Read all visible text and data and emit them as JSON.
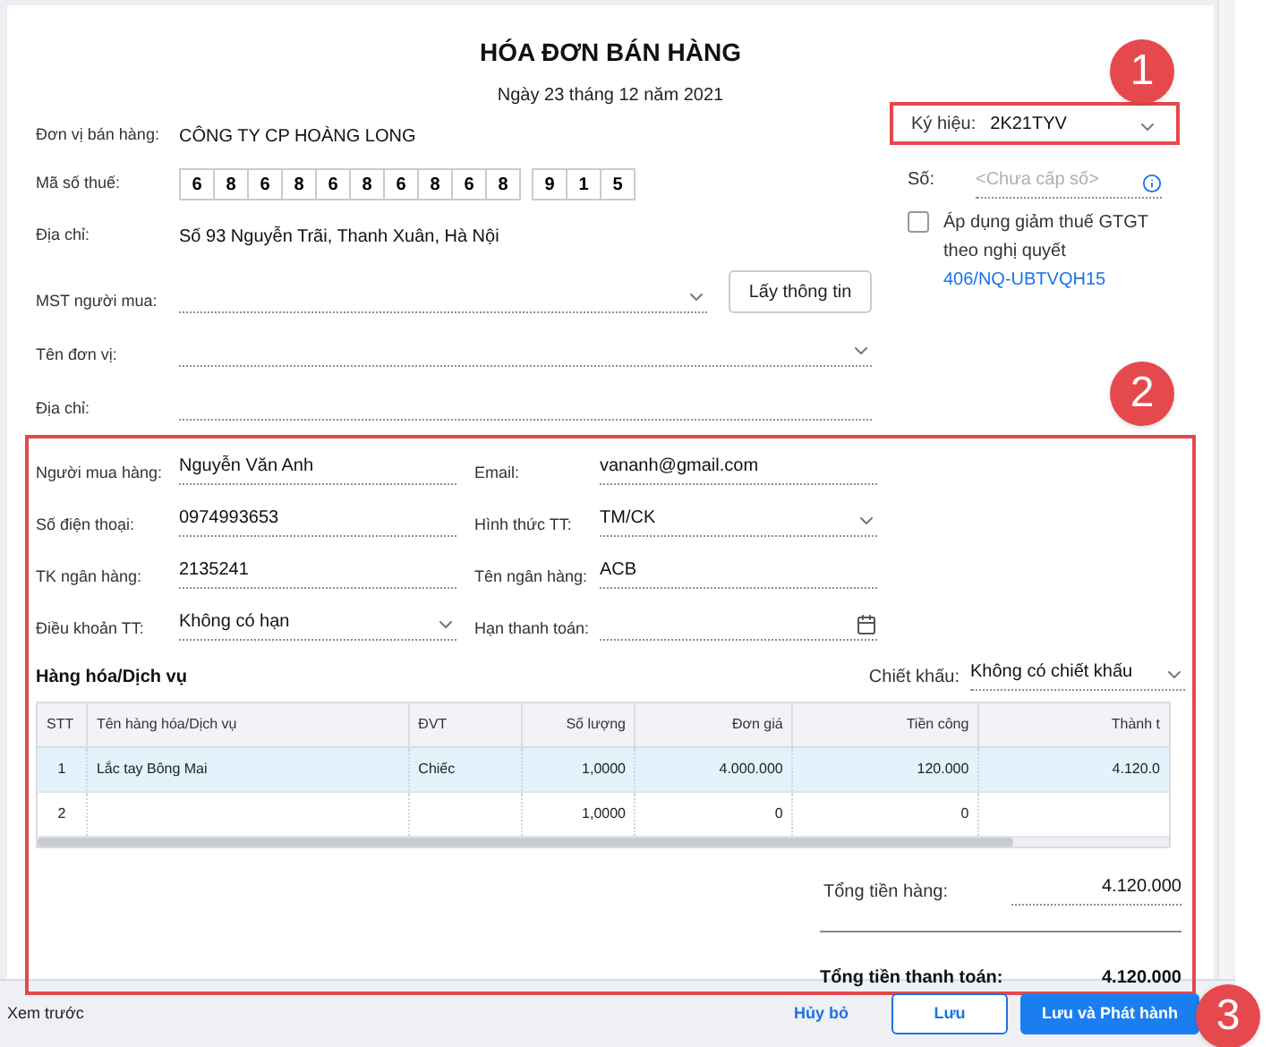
{
  "title": "HÓA ĐƠN BÁN HÀNG",
  "date": "Ngày 23 tháng 12 năm 2021",
  "seller": {
    "name_label": "Đơn vị bán hàng:",
    "name": "CÔNG TY CP HOÀNG LONG",
    "tax_label": "Mã số thuế:",
    "tax_code_main": [
      "6",
      "8",
      "6",
      "8",
      "6",
      "8",
      "6",
      "8",
      "6",
      "8"
    ],
    "tax_code_branch": [
      "9",
      "1",
      "5"
    ],
    "address_label": "Địa chỉ:",
    "address": "Số 93 Nguyễn Trãi, Thanh Xuân, Hà Nội"
  },
  "buyer_lookup": {
    "tax_label": "MST người mua:",
    "button": "Lấy thông tin",
    "unit_label": "Tên đơn vị:",
    "address_label": "Địa chỉ:"
  },
  "invoice_meta": {
    "symbol_label": "Ký hiệu:",
    "symbol": "2K21TYV",
    "number_label": "Số:",
    "number_placeholder": "<Chưa cấp số>",
    "tax_reduction": {
      "checked": false,
      "text": "Áp dụng giảm thuế GTGT theo nghị quyết",
      "link": "406/NQ-UBTVQH15"
    }
  },
  "buyer_fields": [
    {
      "label": "Người mua hàng:",
      "value": "Nguyễn Văn Anh",
      "kind": "text"
    },
    {
      "label": "Email:",
      "value": "vananh@gmail.com",
      "kind": "text"
    },
    {
      "label": "Số điện thoại:",
      "value": "0974993653",
      "kind": "text"
    },
    {
      "label": "Hình thức TT:",
      "value": "TM/CK",
      "kind": "select"
    },
    {
      "label": "TK ngân hàng:",
      "value": "2135241",
      "kind": "text"
    },
    {
      "label": "Tên ngân hàng:",
      "value": "ACB",
      "kind": "text"
    },
    {
      "label": "Điều khoản TT:",
      "value": "Không có hạn",
      "kind": "select"
    },
    {
      "label": "Hạn thanh toán:",
      "kind": "date"
    }
  ],
  "goods": {
    "title": "Hàng hóa/Dịch vụ",
    "discount_label": "Chiết khấu:",
    "discount_value": "Không có chiết khấu",
    "columns": [
      "STT",
      "Tên hàng hóa/Dịch vụ",
      "ĐVT",
      "Số lượng",
      "Đơn giá",
      "Tiền công",
      "Thành t"
    ],
    "rows": [
      {
        "selected": true,
        "cells": [
          "1",
          "Lắc tay Bông Mai",
          "Chiếc",
          "1,0000",
          "4.000.000",
          "120.000",
          "4.120.0"
        ]
      },
      {
        "selected": false,
        "cells": [
          "2",
          null,
          null,
          "1,0000",
          "0",
          "0",
          null
        ]
      }
    ]
  },
  "totals": [
    {
      "kind": "subtotal",
      "label": "Tổng tiền hàng:",
      "value": "4.120.000"
    },
    {
      "kind": "total",
      "label": "Tổng tiền thanh toán:",
      "value": "4.120.000"
    }
  ],
  "footer": {
    "preview": "Xem trước",
    "cancel": "Hủy bỏ",
    "save": "Lưu",
    "save_publish": "Lưu và Phát hành"
  },
  "callouts": [
    "1",
    "2",
    "3"
  ]
}
